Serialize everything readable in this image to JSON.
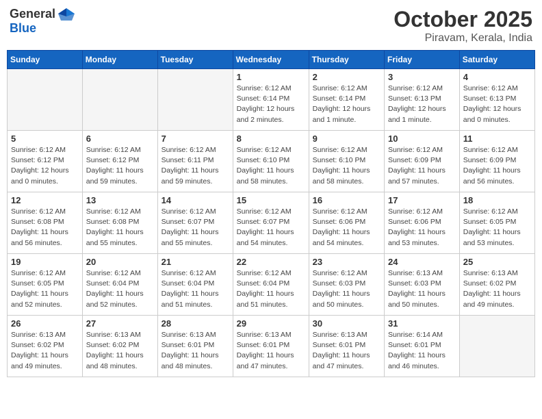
{
  "logo": {
    "general": "General",
    "blue": "Blue"
  },
  "title": "October 2025",
  "location": "Piravam, Kerala, India",
  "weekdays": [
    "Sunday",
    "Monday",
    "Tuesday",
    "Wednesday",
    "Thursday",
    "Friday",
    "Saturday"
  ],
  "weeks": [
    [
      {
        "day": "",
        "info": ""
      },
      {
        "day": "",
        "info": ""
      },
      {
        "day": "",
        "info": ""
      },
      {
        "day": "1",
        "info": "Sunrise: 6:12 AM\nSunset: 6:14 PM\nDaylight: 12 hours\nand 2 minutes."
      },
      {
        "day": "2",
        "info": "Sunrise: 6:12 AM\nSunset: 6:14 PM\nDaylight: 12 hours\nand 1 minute."
      },
      {
        "day": "3",
        "info": "Sunrise: 6:12 AM\nSunset: 6:13 PM\nDaylight: 12 hours\nand 1 minute."
      },
      {
        "day": "4",
        "info": "Sunrise: 6:12 AM\nSunset: 6:13 PM\nDaylight: 12 hours\nand 0 minutes."
      }
    ],
    [
      {
        "day": "5",
        "info": "Sunrise: 6:12 AM\nSunset: 6:12 PM\nDaylight: 12 hours\nand 0 minutes."
      },
      {
        "day": "6",
        "info": "Sunrise: 6:12 AM\nSunset: 6:12 PM\nDaylight: 11 hours\nand 59 minutes."
      },
      {
        "day": "7",
        "info": "Sunrise: 6:12 AM\nSunset: 6:11 PM\nDaylight: 11 hours\nand 59 minutes."
      },
      {
        "day": "8",
        "info": "Sunrise: 6:12 AM\nSunset: 6:10 PM\nDaylight: 11 hours\nand 58 minutes."
      },
      {
        "day": "9",
        "info": "Sunrise: 6:12 AM\nSunset: 6:10 PM\nDaylight: 11 hours\nand 58 minutes."
      },
      {
        "day": "10",
        "info": "Sunrise: 6:12 AM\nSunset: 6:09 PM\nDaylight: 11 hours\nand 57 minutes."
      },
      {
        "day": "11",
        "info": "Sunrise: 6:12 AM\nSunset: 6:09 PM\nDaylight: 11 hours\nand 56 minutes."
      }
    ],
    [
      {
        "day": "12",
        "info": "Sunrise: 6:12 AM\nSunset: 6:08 PM\nDaylight: 11 hours\nand 56 minutes."
      },
      {
        "day": "13",
        "info": "Sunrise: 6:12 AM\nSunset: 6:08 PM\nDaylight: 11 hours\nand 55 minutes."
      },
      {
        "day": "14",
        "info": "Sunrise: 6:12 AM\nSunset: 6:07 PM\nDaylight: 11 hours\nand 55 minutes."
      },
      {
        "day": "15",
        "info": "Sunrise: 6:12 AM\nSunset: 6:07 PM\nDaylight: 11 hours\nand 54 minutes."
      },
      {
        "day": "16",
        "info": "Sunrise: 6:12 AM\nSunset: 6:06 PM\nDaylight: 11 hours\nand 54 minutes."
      },
      {
        "day": "17",
        "info": "Sunrise: 6:12 AM\nSunset: 6:06 PM\nDaylight: 11 hours\nand 53 minutes."
      },
      {
        "day": "18",
        "info": "Sunrise: 6:12 AM\nSunset: 6:05 PM\nDaylight: 11 hours\nand 53 minutes."
      }
    ],
    [
      {
        "day": "19",
        "info": "Sunrise: 6:12 AM\nSunset: 6:05 PM\nDaylight: 11 hours\nand 52 minutes."
      },
      {
        "day": "20",
        "info": "Sunrise: 6:12 AM\nSunset: 6:04 PM\nDaylight: 11 hours\nand 52 minutes."
      },
      {
        "day": "21",
        "info": "Sunrise: 6:12 AM\nSunset: 6:04 PM\nDaylight: 11 hours\nand 51 minutes."
      },
      {
        "day": "22",
        "info": "Sunrise: 6:12 AM\nSunset: 6:04 PM\nDaylight: 11 hours\nand 51 minutes."
      },
      {
        "day": "23",
        "info": "Sunrise: 6:12 AM\nSunset: 6:03 PM\nDaylight: 11 hours\nand 50 minutes."
      },
      {
        "day": "24",
        "info": "Sunrise: 6:13 AM\nSunset: 6:03 PM\nDaylight: 11 hours\nand 50 minutes."
      },
      {
        "day": "25",
        "info": "Sunrise: 6:13 AM\nSunset: 6:02 PM\nDaylight: 11 hours\nand 49 minutes."
      }
    ],
    [
      {
        "day": "26",
        "info": "Sunrise: 6:13 AM\nSunset: 6:02 PM\nDaylight: 11 hours\nand 49 minutes."
      },
      {
        "day": "27",
        "info": "Sunrise: 6:13 AM\nSunset: 6:02 PM\nDaylight: 11 hours\nand 48 minutes."
      },
      {
        "day": "28",
        "info": "Sunrise: 6:13 AM\nSunset: 6:01 PM\nDaylight: 11 hours\nand 48 minutes."
      },
      {
        "day": "29",
        "info": "Sunrise: 6:13 AM\nSunset: 6:01 PM\nDaylight: 11 hours\nand 47 minutes."
      },
      {
        "day": "30",
        "info": "Sunrise: 6:13 AM\nSunset: 6:01 PM\nDaylight: 11 hours\nand 47 minutes."
      },
      {
        "day": "31",
        "info": "Sunrise: 6:14 AM\nSunset: 6:01 PM\nDaylight: 11 hours\nand 46 minutes."
      },
      {
        "day": "",
        "info": ""
      }
    ]
  ]
}
